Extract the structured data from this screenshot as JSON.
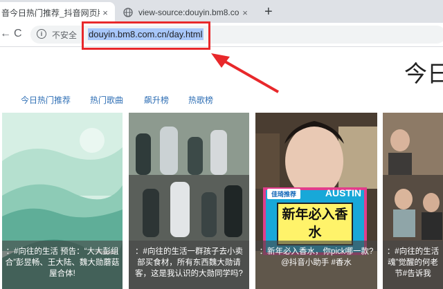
{
  "browser": {
    "tabs": [
      {
        "title": "音今日热门推荐_抖音网页版|抖",
        "close": "×"
      },
      {
        "title": "view-source:douyin.bm8.com.c",
        "close": "×"
      }
    ],
    "new_tab": "+",
    "nav": {
      "back": "←",
      "reload": "C"
    },
    "omnibox": {
      "security": "不安全",
      "info": "i",
      "url": "douyin.bm8.com.cn/day.html"
    }
  },
  "page": {
    "title": "今日",
    "nav": [
      "今日热门推荐",
      "热门歌曲",
      "飙升榜",
      "热歌榜"
    ],
    "cards": [
      {
        "caption": "：#向往的生活 预告：“大大彭组合”彭昱畅、王大陆、魏大勋蘑菇屋合体!"
      },
      {
        "caption": "：#向往的生活一群孩子去小卖部买食材，所有东西魏大勋请客，这是我认识的大勋同学吗?"
      },
      {
        "caption": "：新年必入香水，你pick哪一款? @抖音小助手 #香水",
        "sticker_badge": "佳琦推荐",
        "sticker_brand": "AUSTIN",
        "sticker_text": "新年必入香水"
      },
      {
        "caption": "：#向往的生活魂”觉醒的何老节#告诉我"
      }
    ]
  },
  "colors": {
    "tabbar": "#dee1e6",
    "highlight_box": "#e8282b",
    "nav_link": "#2f6fb5"
  }
}
